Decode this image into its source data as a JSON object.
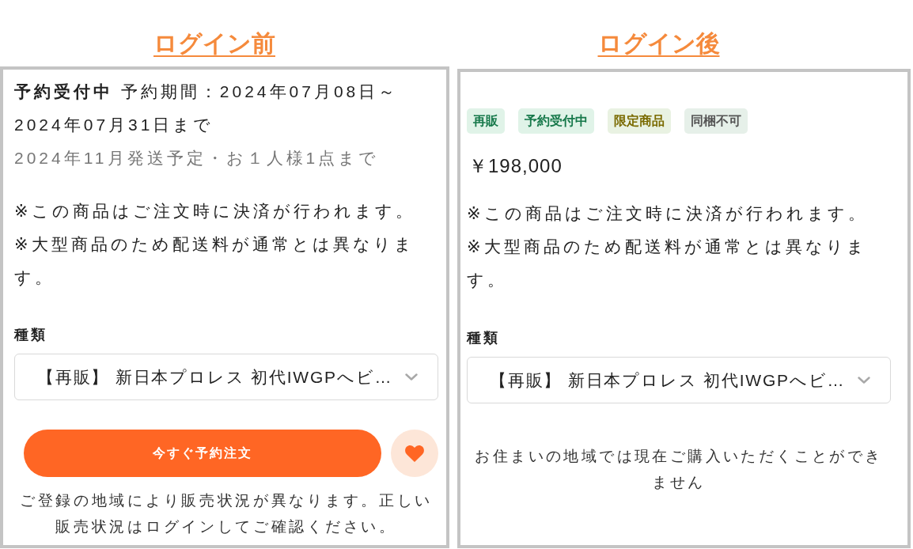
{
  "panels": [
    {
      "heading": "ログイン前",
      "reservation": "**予約受付中** 予約期間：2024年07月08日～2024年07月31日まで",
      "shipping": "2024年11月発送予定・お１人様1点まで",
      "notes": [
        "※この商品はご注文時に決済が行われます。",
        "※大型商品のため配送料が通常とは異なります。"
      ],
      "variant": {
        "label": "種類",
        "value": "【再販】 新日本プロレス 初代IWGPへビ…"
      },
      "order_button": "今すぐ予約注文",
      "notice": "ご登録の地域により販売状況が異なります。正しい販売状況はログインしてご確認ください。"
    },
    {
      "heading": "ログイン後",
      "tags": [
        {
          "label": "再販",
          "color": "#16784a"
        },
        {
          "label": "予約受付中",
          "color": "#16784a"
        },
        {
          "label": "限定商品",
          "color": "#7a6a00"
        },
        {
          "label": "同梱不可",
          "color": "#555555"
        }
      ],
      "price": "￥198,000",
      "notes": [
        "※この商品はご注文時に決済が行われます。",
        "※大型商品のため配送料が通常とは異なります。"
      ],
      "variant": {
        "label": "種類",
        "value": "【再販】 新日本プロレス 初代IWGPへビ…"
      },
      "notice": "お住まいの地域では現在ご購入いただくことができません"
    }
  ]
}
